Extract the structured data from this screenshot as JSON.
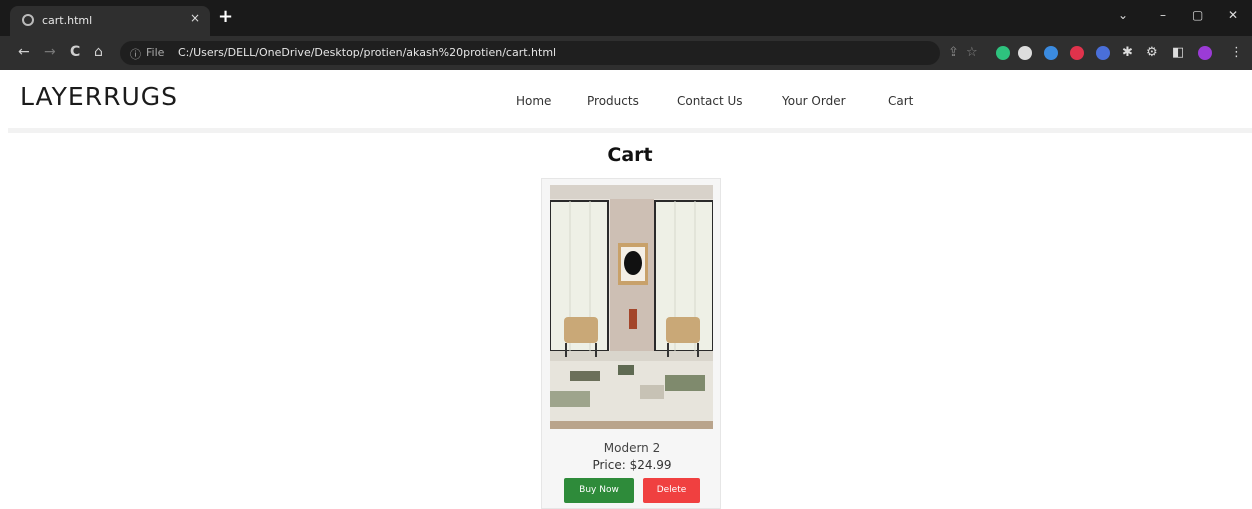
{
  "browser": {
    "tab_title": "cart.html",
    "tab_close": "×",
    "new_tab": "+",
    "window_controls": [
      "⌄",
      "–",
      "▢",
      "✕"
    ],
    "url_info": "ⓘ",
    "url_scheme": "File",
    "url": "C:/Users/DELL/OneDrive/Desktop/protien/akash%20protien/cart.html",
    "nav": {
      "back": "←",
      "forward": "→",
      "reload": "C",
      "home": "⌂"
    }
  },
  "site": {
    "logo": "LAYERRUGS",
    "nav": [
      "Home",
      "Products",
      "Contact Us",
      "Your Order",
      "Cart"
    ]
  },
  "page": {
    "title": "Cart"
  },
  "cart": {
    "items": [
      {
        "name": "Modern 2",
        "price": "Price: $24.99",
        "buy_label": "Buy Now",
        "delete_label": "Delete"
      }
    ]
  },
  "colors": {
    "buy_button": "#2e8b3a",
    "delete_button": "#f04040",
    "chrome_dark": "#1a1a1a"
  }
}
